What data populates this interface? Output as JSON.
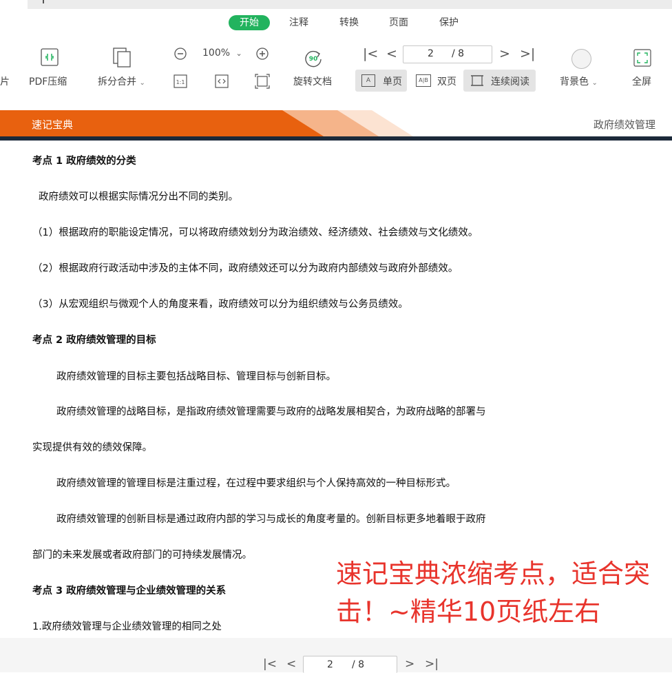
{
  "tabs": [
    {
      "label": "开始",
      "active": true
    },
    {
      "label": "注释",
      "active": false
    },
    {
      "label": "转换",
      "active": false
    },
    {
      "label": "页面",
      "active": false
    },
    {
      "label": "保护",
      "active": false
    }
  ],
  "toolbar": {
    "left_partial": "片",
    "pdf_compress": "PDF压缩",
    "split_merge": "拆分合并",
    "zoom": "100%",
    "rotate": "旋转文档",
    "current_page": "2",
    "page_total": "/ 8",
    "single_page": "单页",
    "double_page": "双页",
    "continuous": "连续阅读",
    "background": "背景色",
    "fullscreen": "全屏",
    "icon_text_rotate": "90",
    "icon_text_oneone": "1:1",
    "icon_text_single": "A",
    "icon_text_double": "A|B"
  },
  "banner": {
    "left": "速记宝典",
    "right": "政府绩效管理",
    "colors": {
      "orange": "#e8610f",
      "light": "#f5b48a",
      "pale": "#fce3d2",
      "rule": "#1c2a3a"
    }
  },
  "document": {
    "h1": "考点 1  政府绩效的分类",
    "p1": "政府绩效可以根据实际情况分出不同的类别。",
    "p2": "（1）根据政府的职能设定情况，可以将政府绩效划分为政治绩效、经济绩效、社会绩效与文化绩效。",
    "p3": "（2）根据政府行政活动中涉及的主体不同，政府绩效还可以分为政府内部绩效与政府外部绩效。",
    "p4": "（3）从宏观组织与微观个人的角度来看，政府绩效可以分为组织绩效与公务员绩效。",
    "h2": "考点 2  政府绩效管理的目标",
    "p5": "政府绩效管理的目标主要包括战略目标、管理目标与创新目标。",
    "p6a": "政府绩效管理的战略目标，是指政府绩效管理需要与政府的战略发展相契合，为政府战略的部署与",
    "p6b": "实现提供有效的绩效保障。",
    "p7": "政府绩效管理的管理目标是注重过程，在过程中要求组织与个人保持高效的一种目标形式。",
    "p8a": "政府绩效管理的创新目标是通过政府内部的学习与成长的角度考量的。创新目标更多地着眼于政府",
    "p8b": "部门的未来发展或者政府部门的可持续发展情况。",
    "h3": "考点 3  政府绩效管理与企业绩效管理的关系",
    "p9": "1.政府绩效管理与企业绩效管理的相同之处"
  },
  "overlay": {
    "line1": "速记宝典浓缩考点，适合突",
    "line2": "击！~精华10页纸左右",
    "color": "#e8342c"
  },
  "bottom_nav": {
    "current_page": "2",
    "page_total": "/ 8"
  },
  "accent": "#22b35e"
}
